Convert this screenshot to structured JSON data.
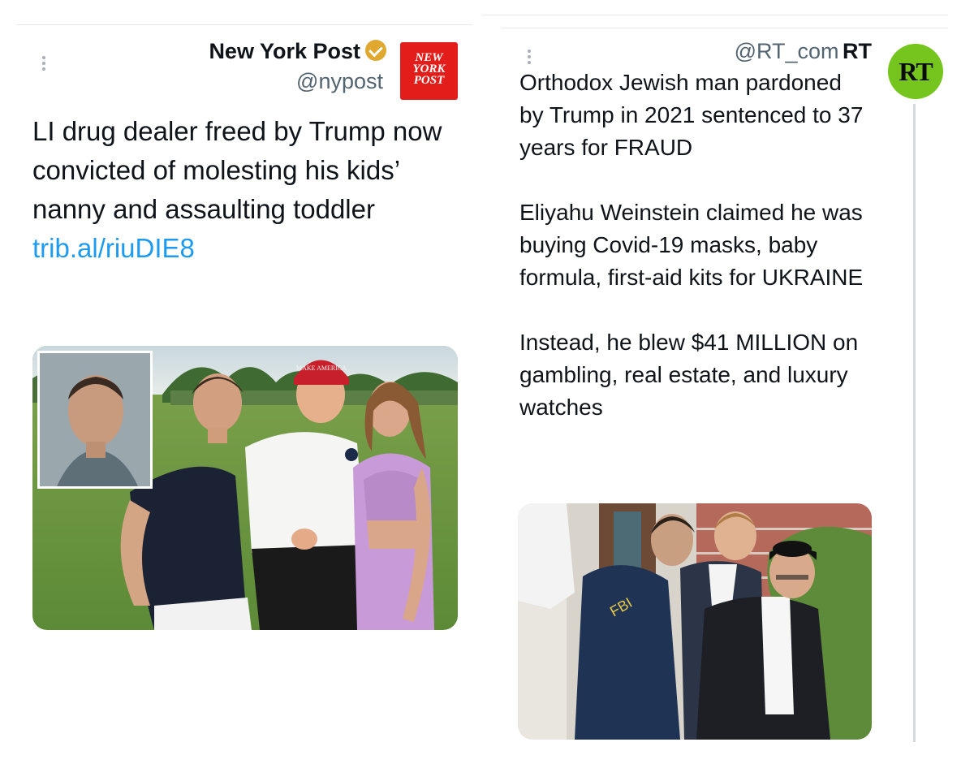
{
  "left_tweet": {
    "author_name": "New York Post",
    "handle": "@nypost",
    "logo_lines": [
      "NEW",
      "YORK",
      "POST"
    ],
    "text": "LI drug dealer freed by Trump now convicted of molesting his kids’ nanny and assaulting toddler",
    "link": "trib.al/riuDIE8",
    "hat_text": "MAKE AMERICA GREAT AGAIN"
  },
  "right_tweet": {
    "handle": "@RT_com",
    "author_name": "RT",
    "logo": "RT",
    "paragraphs": [
      "Orthodox Jewish man pardoned by Trump in 2021 sentenced to 37 years for FRAUD",
      "Eliyahu Weinstein claimed he was buying Covid-19 masks, baby formula, first-aid kits for UKRAINE",
      "Instead, he blew $41 MILLION on gambling, real estate, and luxury watches"
    ],
    "jacket_text": "FBI"
  },
  "colors": {
    "link": "#1d9bf0",
    "verified_badge": "#e0a82e",
    "nypost_red": "#e31d1a",
    "rt_green": "#76c51e"
  }
}
